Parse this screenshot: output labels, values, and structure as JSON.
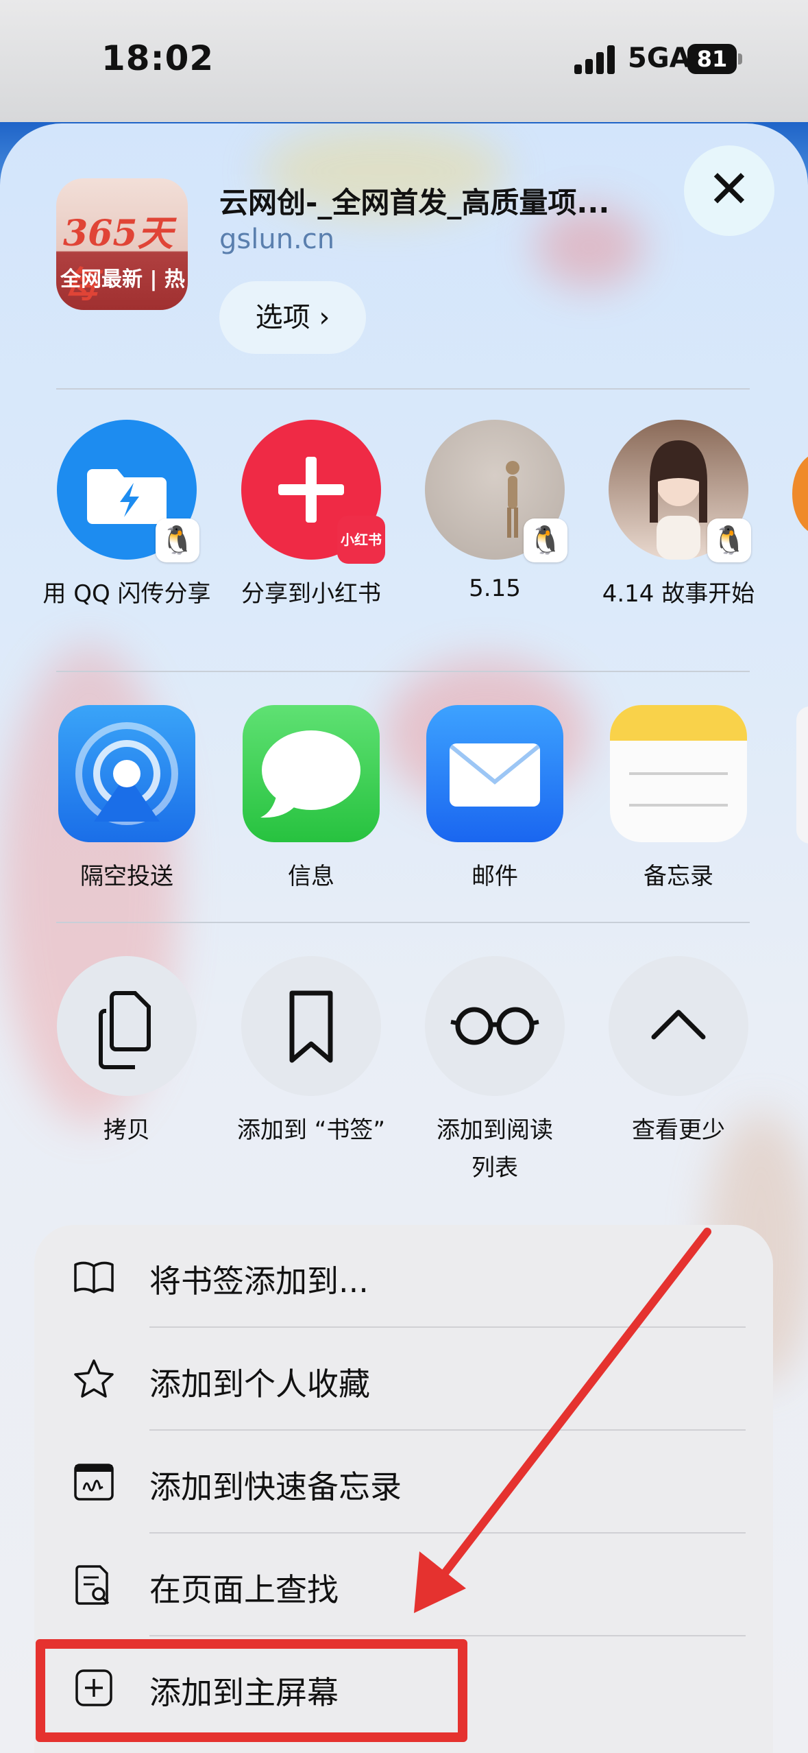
{
  "status_bar": {
    "time": "18:02",
    "network": "5GA",
    "battery": "81"
  },
  "site": {
    "thumb_text_top": "365天 每",
    "thumb_text_bottom": "全网最新 | 热",
    "title": "云网创-_全网首发_高质量项...",
    "url": "gslun.cn",
    "options_label": "选项 ›"
  },
  "close_icon": "✕",
  "contacts": [
    {
      "label": "用 QQ 闪传分享"
    },
    {
      "label": "分享到小红书",
      "badge": "小红书"
    },
    {
      "label": "5.15"
    },
    {
      "label": "4.14 故事开始"
    }
  ],
  "apps": [
    {
      "label": "隔空投送"
    },
    {
      "label": "信息"
    },
    {
      "label": "邮件"
    },
    {
      "label": "备忘录"
    }
  ],
  "actions": [
    {
      "label": "拷贝"
    },
    {
      "label": "添加到 “书签”"
    },
    {
      "label_line1": "添加到阅读",
      "label_line2": "列表"
    },
    {
      "label": "查看更少"
    }
  ],
  "menu": [
    {
      "label": "将书签添加到...",
      "icon": "book-icon"
    },
    {
      "label": "添加到个人收藏",
      "icon": "star-icon"
    },
    {
      "label": "添加到快速备忘录",
      "icon": "quick-note-icon"
    },
    {
      "label": "在页面上查找",
      "icon": "find-icon"
    },
    {
      "label": "添加到主屏幕",
      "icon": "add-square-icon"
    }
  ],
  "colors": {
    "highlight": "#e5322f",
    "arrow": "#e5322f"
  }
}
